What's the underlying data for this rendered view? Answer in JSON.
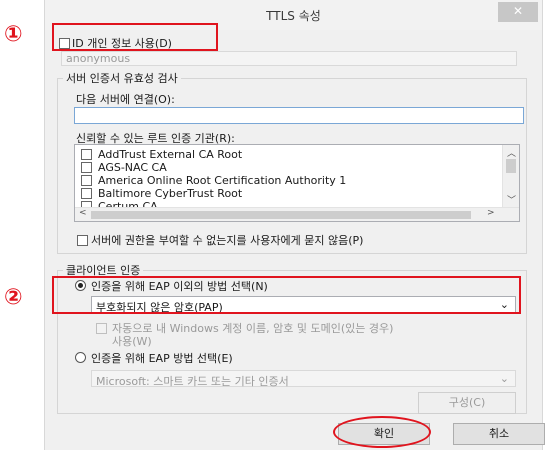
{
  "window": {
    "title": "TTLS 속성",
    "close_label": "✕"
  },
  "annotations": {
    "marker_1": "①",
    "marker_2": "②"
  },
  "identity": {
    "checkbox_label": "ID 개인 정보 사용(D)",
    "anonymous_value": "anonymous"
  },
  "server_validation": {
    "group_title": "서버 인증서 유효성 검사",
    "connect_label": "다음 서버에 연결(O):",
    "connect_value": "",
    "root_ca_label": "신뢰할 수 있는 루트 인증 기관(R):",
    "root_cas": [
      "AddTrust External CA Root",
      "AGS-NAC CA",
      "America Online Root Certification Authority 1",
      "Baltimore CyberTrust Root",
      "Certum CA"
    ],
    "no_prompt_label": "서버에 권한을 부여할 수 없는지를 사용자에게 묻지 않음(P)"
  },
  "client_auth": {
    "group_title": "클라이언트 인증",
    "non_eap_label": "인증을 위해 EAP 이외의 방법 선택(N)",
    "non_eap_method": "부호화되지 않은 암호(PAP)",
    "auto_windows_label_line1": "자동으로 내 Windows 계정 이름, 암호 및 도메인(있는 경우)",
    "auto_windows_label_line2": "사용(W)",
    "eap_label": "인증을 위해 EAP 방법 선택(E)",
    "eap_method": "Microsoft: 스마트 카드 또는 기타 인증서",
    "configure_label": "구성(C)"
  },
  "footer": {
    "ok_label": "확인",
    "cancel_label": "취소"
  },
  "colors": {
    "annotation_red": "#e0141e",
    "dialog_bg": "#f0f0f0"
  }
}
